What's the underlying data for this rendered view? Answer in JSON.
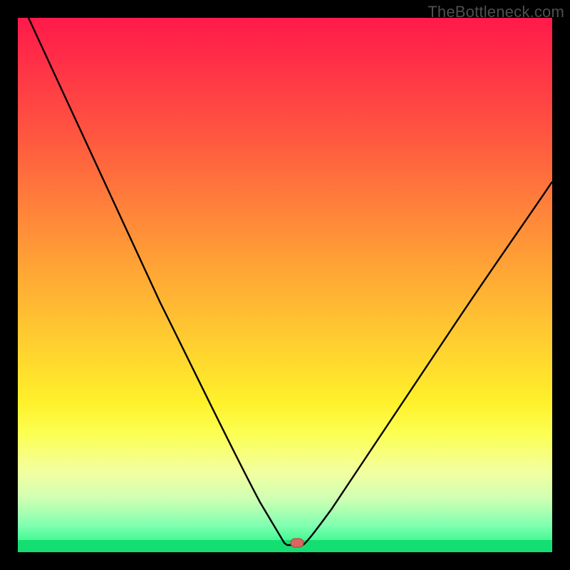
{
  "watermark": "TheBottleneck.com",
  "chart_data": {
    "type": "line",
    "title": "",
    "xlabel": "",
    "ylabel": "",
    "xlim": [
      0,
      100
    ],
    "ylim": [
      0,
      100
    ],
    "series": [
      {
        "name": "bottleneck-curve",
        "x": [
          2,
          8,
          15,
          22,
          30,
          36,
          40,
          43,
          45,
          47,
          49,
          53,
          56,
          62,
          70,
          80,
          90,
          100
        ],
        "values": [
          100,
          88,
          76,
          64,
          50,
          38,
          28,
          19,
          11,
          5,
          1,
          0,
          2,
          10,
          22,
          37,
          51,
          62
        ]
      }
    ],
    "baseline": {
      "name": "zero-line",
      "y": 0,
      "x_range": [
        0,
        100
      ]
    },
    "marker": {
      "name": "optimal-point",
      "x": 52,
      "y": 0,
      "shape": "rounded-pill",
      "color": "#d7675f"
    },
    "background_gradient": {
      "stops": [
        {
          "pos": 0.0,
          "color": "#ff1a4a"
        },
        {
          "pos": 0.22,
          "color": "#ff5640"
        },
        {
          "pos": 0.5,
          "color": "#ffae34"
        },
        {
          "pos": 0.72,
          "color": "#fff12b"
        },
        {
          "pos": 0.9,
          "color": "#cfffb3"
        },
        {
          "pos": 1.0,
          "color": "#18f47f"
        }
      ]
    }
  }
}
